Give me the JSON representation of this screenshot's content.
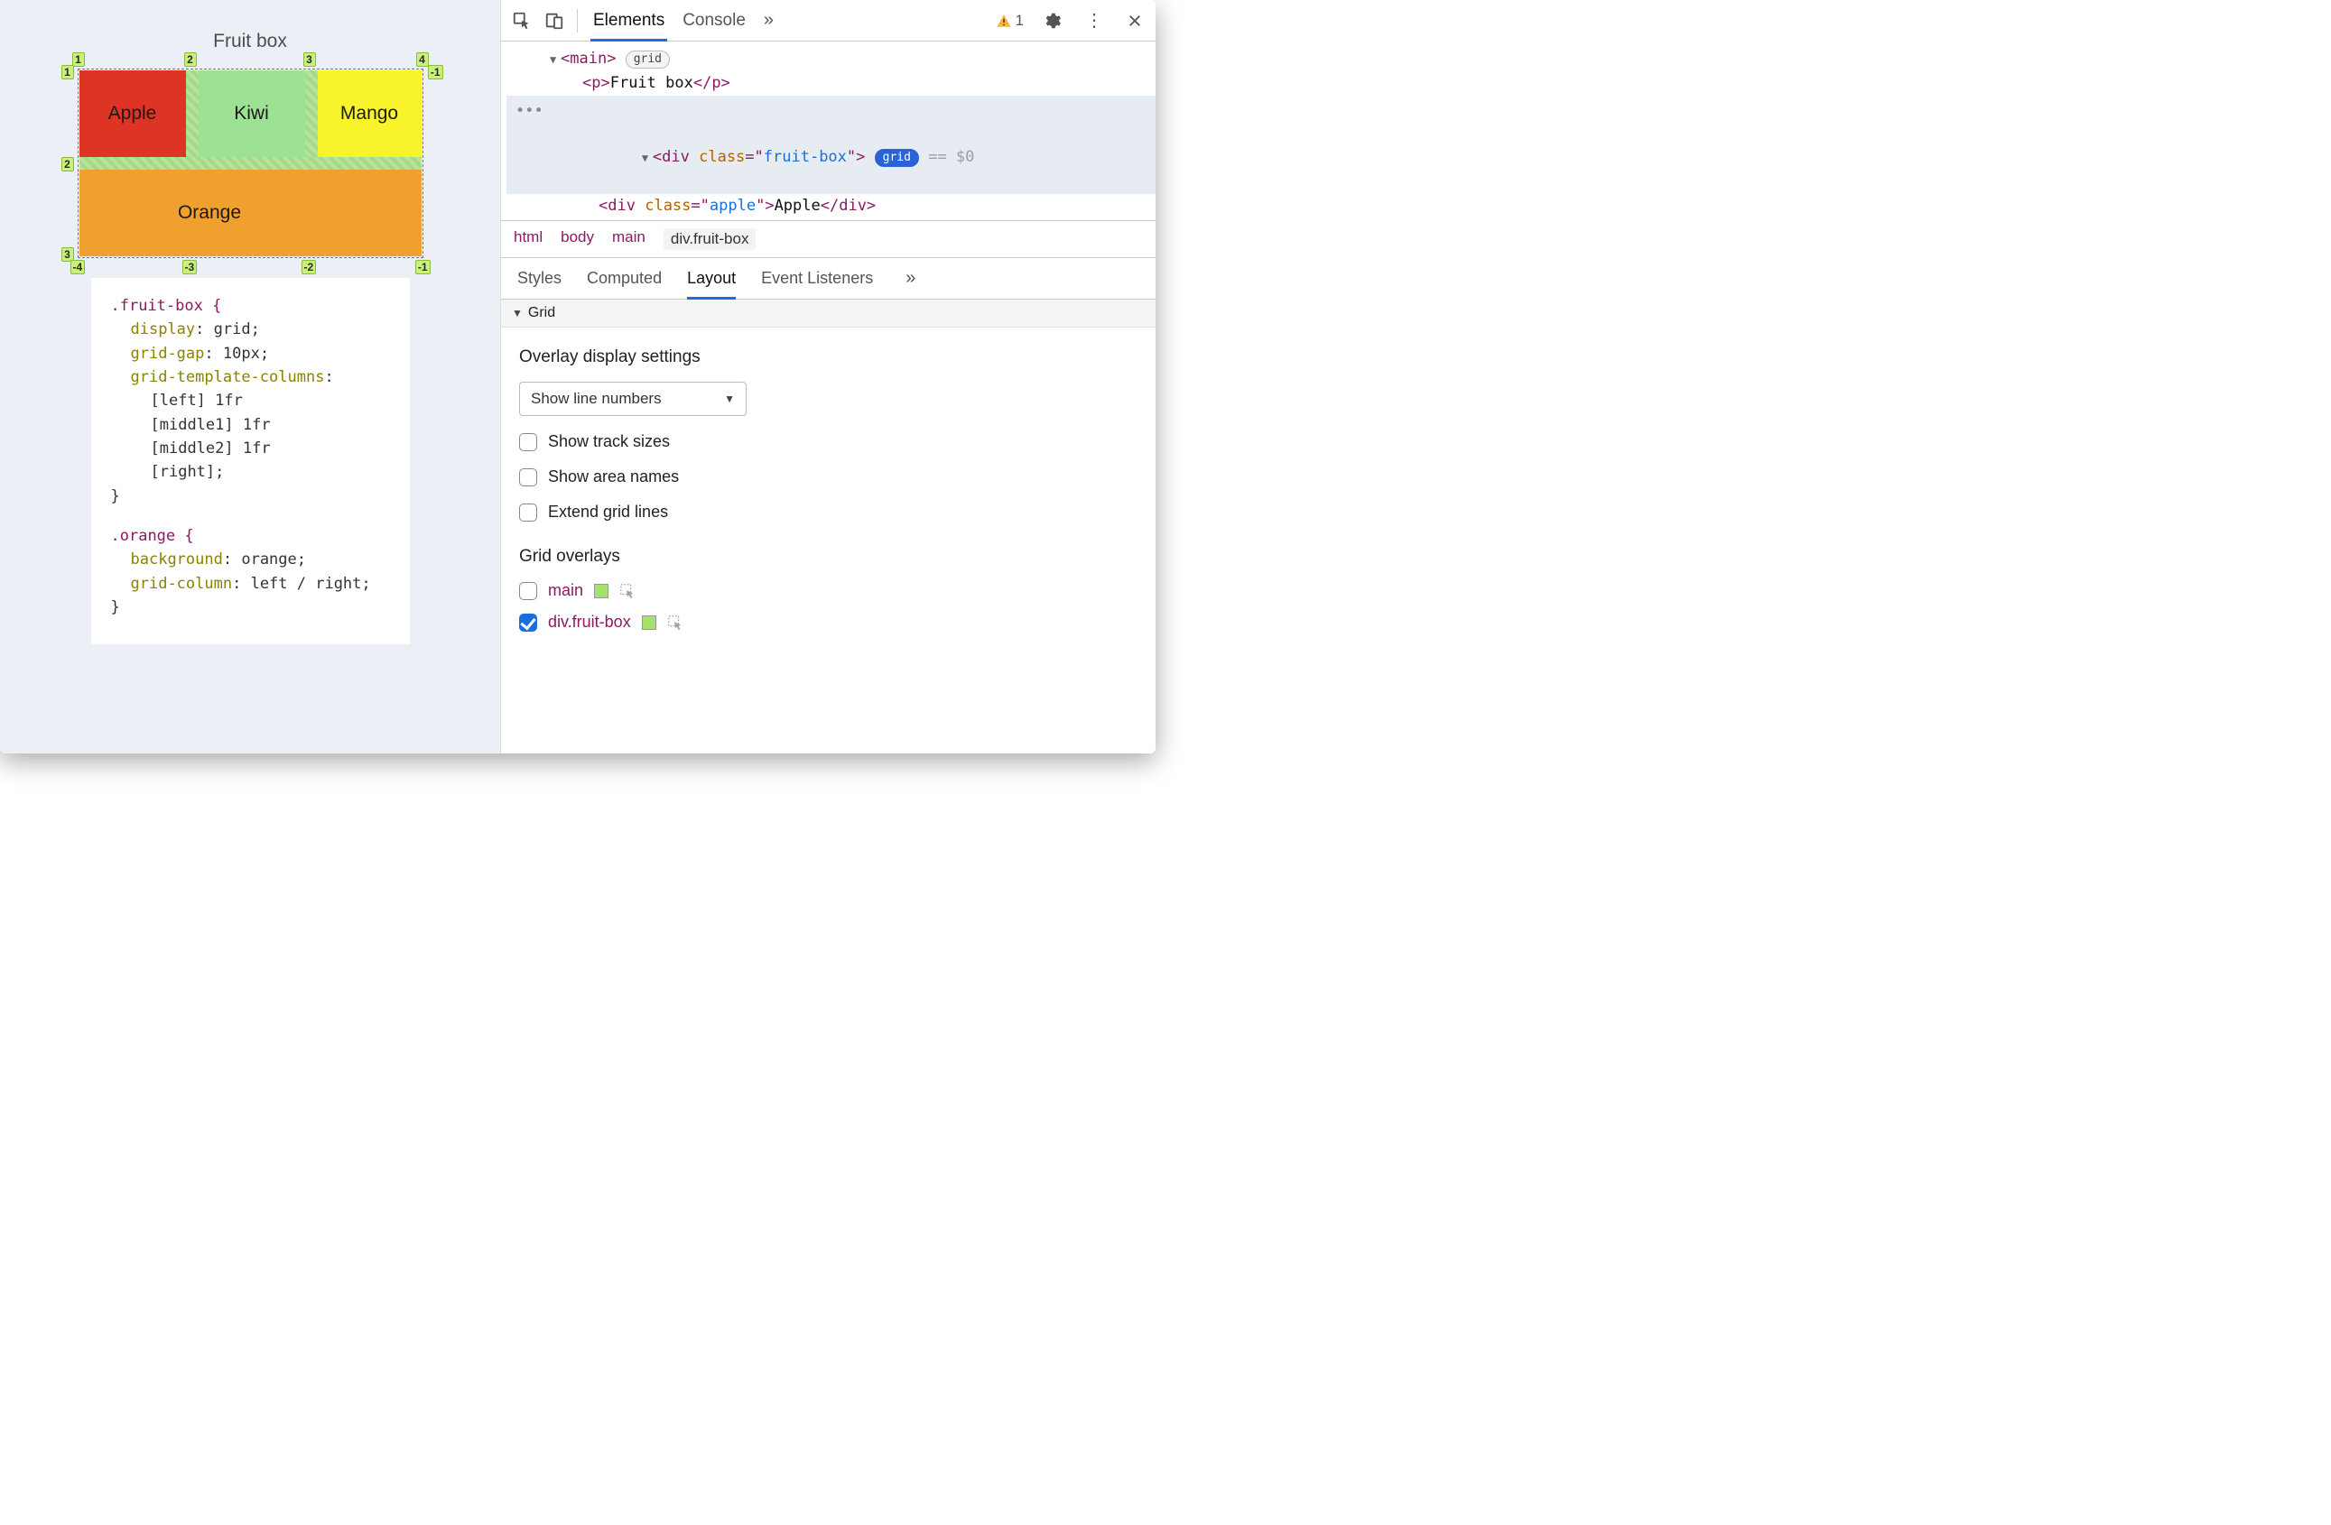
{
  "preview": {
    "title": "Fruit box",
    "cells": {
      "apple": "Apple",
      "kiwi": "Kiwi",
      "mango": "Mango",
      "orange": "Orange"
    },
    "labels_top": [
      "1",
      "2",
      "3",
      "4"
    ],
    "labels_left": [
      "1",
      "2",
      "3"
    ],
    "labels_right": [
      "-1"
    ],
    "labels_bottom": [
      "-4",
      "-3",
      "-2",
      "-1"
    ]
  },
  "css": {
    "rule1_selector": ".fruit-box {",
    "rule1_lines": [
      "display: grid;",
      "grid-gap: 10px;",
      "grid-template-columns:",
      "[left] 1fr",
      "[middle1] 1fr",
      "[middle2] 1fr",
      "[right];"
    ],
    "rule1_close": "}",
    "rule2_selector": ".orange {",
    "rule2_lines": [
      "background: orange;",
      "grid-column: left / right;"
    ],
    "rule2_close": "}"
  },
  "toolbar": {
    "tabs": {
      "elements": "Elements",
      "console": "Console"
    },
    "more": "»",
    "warn_count": "1"
  },
  "dom": {
    "main_open": "<main>",
    "main_badge": "grid",
    "p_text": "Fruit box",
    "sel_tag": "div",
    "sel_attr": "class",
    "sel_val": "fruit-box",
    "sel_badge": "grid",
    "eq": "== $0",
    "child_tag": "div",
    "child_attr": "class",
    "child_val": "apple",
    "child_text": "Apple"
  },
  "breadcrumbs": [
    "html",
    "body",
    "main",
    "div.fruit-box"
  ],
  "panel_tabs": {
    "styles": "Styles",
    "computed": "Computed",
    "layout": "Layout",
    "listeners": "Event Listeners",
    "more": "»"
  },
  "grid_section": {
    "heading": "Grid",
    "sub1": "Overlay display settings",
    "select": "Show line numbers",
    "opt1": "Show track sizes",
    "opt2": "Show area names",
    "opt3": "Extend grid lines",
    "sub2": "Grid overlays",
    "overlays": [
      {
        "name": "main",
        "checked": false,
        "swatch": "#a6e26a"
      },
      {
        "name": "div.fruit-box",
        "checked": true,
        "swatch": "#a6e26a"
      }
    ]
  }
}
